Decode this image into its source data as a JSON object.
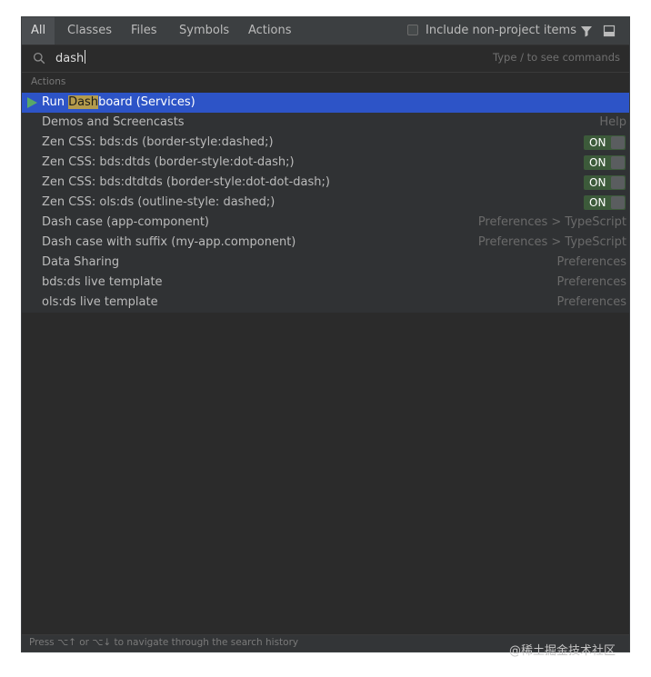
{
  "tabs": [
    {
      "label": "All",
      "active": true
    },
    {
      "label": "Classes"
    },
    {
      "label": "Files"
    },
    {
      "label": "Symbols"
    },
    {
      "label": "Actions"
    }
  ],
  "include_non_project": {
    "label": "Include non-project items",
    "checked": false
  },
  "icons": {
    "filter": "filter-icon",
    "layout": "layout-icon",
    "search": "search-icon",
    "run": "run-icon"
  },
  "search": {
    "value": "dash",
    "hint": "Type / to see commands"
  },
  "section": "Actions",
  "results": [
    {
      "pre": "Run ",
      "match": "Dash",
      "post": "board (Services)",
      "selected": true
    },
    {
      "label": "Demos and Screencasts",
      "hint": "Help"
    },
    {
      "label": "Zen CSS: bds:ds (border-style:dashed;)",
      "toggle": "ON"
    },
    {
      "label": "Zen CSS: bds:dtds (border-style:dot-dash;)",
      "toggle": "ON"
    },
    {
      "label": "Zen CSS: bds:dtdtds (border-style:dot-dot-dash;)",
      "toggle": "ON"
    },
    {
      "label": "Zen CSS: ols:ds (outline-style: dashed;)",
      "toggle": "ON"
    },
    {
      "label": "Dash case (app-component)",
      "hint": "Preferences > TypeScript"
    },
    {
      "label": "Dash case with suffix (my-app.component)",
      "hint": "Preferences > TypeScript"
    },
    {
      "label": "Data Sharing",
      "hint": "Preferences"
    },
    {
      "label": "bds:ds live template",
      "hint": "Preferences"
    },
    {
      "label": "ols:ds live template",
      "hint": "Preferences"
    }
  ],
  "footer": "Press ⌥↑ or ⌥↓ to navigate through the search history",
  "watermark": "@稀土掘金技术社区",
  "colors": {
    "selection": "#2d54c7",
    "background": "#2b2b2b",
    "toggle_on": "#3c5a3a",
    "match_highlight": "#b49b4c"
  }
}
